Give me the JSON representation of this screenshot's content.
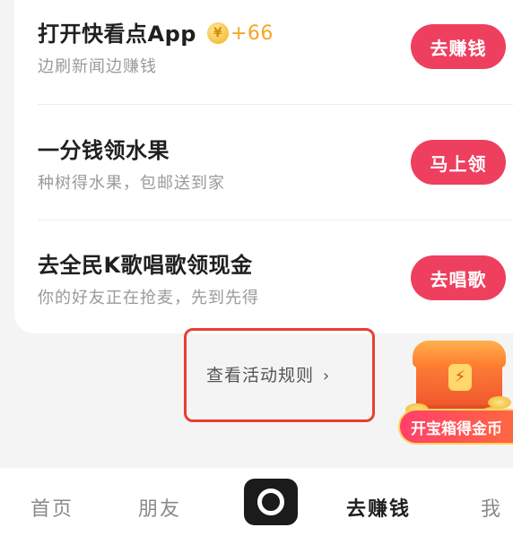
{
  "tasks": [
    {
      "title": "打开快看点App",
      "bonus": "+66",
      "subtitle": "边刷新闻边赚钱",
      "button": "去赚钱",
      "coin_icon": "coin-icon"
    },
    {
      "title": "一分钱领水果",
      "subtitle": "种树得水果，包邮送到家",
      "button": "马上领"
    },
    {
      "title": "去全民K歌唱歌领现金",
      "subtitle": "你的好友正在抢麦，先到先得",
      "button": "去唱歌"
    }
  ],
  "rules": {
    "label": "查看活动规则",
    "chevron": "›"
  },
  "chest": {
    "label": "开宝箱得金币",
    "lock_glyph": "⚡"
  },
  "bottom_nav": {
    "home": "首页",
    "friends": "朋友",
    "earn": "去赚钱",
    "me": "我"
  },
  "colors": {
    "accent": "#ee3f5e",
    "bonus": "#f5a623",
    "highlight": "#e8402f"
  }
}
